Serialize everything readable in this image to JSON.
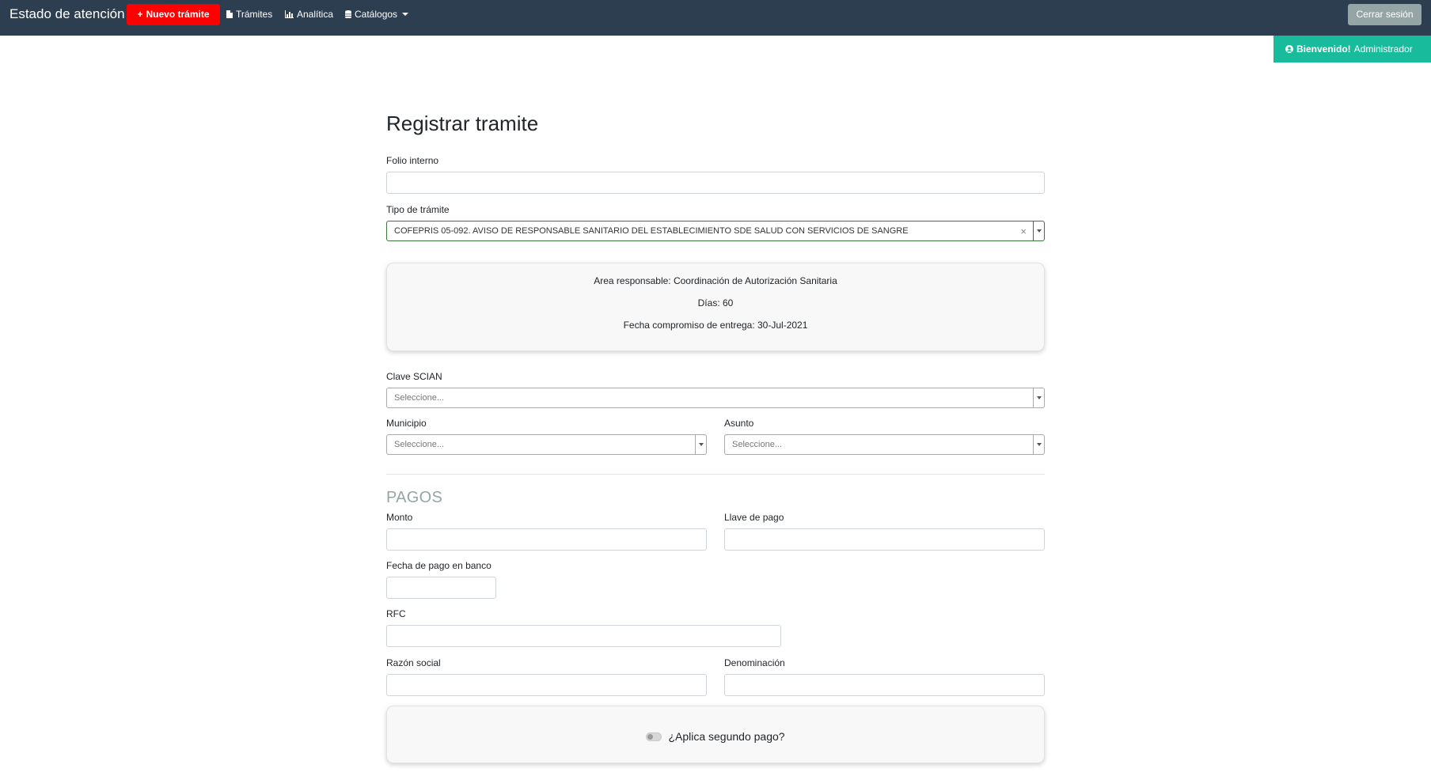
{
  "navbar": {
    "brand": "Estado de atención",
    "new_button": "Nuevo trámite",
    "links": {
      "tramites": "Trámites",
      "analitica": "Analítica",
      "catalogos": "Catálogos"
    },
    "logout_button": "Cerrar sesión",
    "colors": {
      "background": "#2c3e50",
      "new_button": "#ff0000",
      "logout_button": "#95a5a6"
    }
  },
  "welcome": {
    "bold": "Bienvenido!",
    "user": "Administrador",
    "color": "#18bc9c"
  },
  "form": {
    "title": "Registrar tramite",
    "folio": {
      "label": "Folio interno",
      "value": ""
    },
    "tipo": {
      "label": "Tipo de trámite",
      "value": "COFEPRIS 05-092. AVISO DE RESPONSABLE SANITARIO DEL ESTABLECIMIENTO SDE SALUD CON SERVICIOS DE SANGRE",
      "clear": "×"
    },
    "info_card": {
      "area": "Area responsable: Coordinación de Autorización Sanitaria",
      "dias": "Días: 60",
      "fecha": "Fecha compromiso de entrega: 30-Jul-2021"
    },
    "scian": {
      "label": "Clave SCIAN",
      "placeholder": "Seleccione..."
    },
    "municipio": {
      "label": "Municipio",
      "placeholder": "Seleccione..."
    },
    "asunto": {
      "label": "Asunto",
      "placeholder": "Seleccione..."
    }
  },
  "pagos": {
    "title": "PAGOS",
    "monto": {
      "label": "Monto",
      "value": ""
    },
    "llave": {
      "label": "Llave de pago",
      "value": ""
    },
    "fecha_banco": {
      "label": "Fecha de pago en banco",
      "value": ""
    },
    "rfc": {
      "label": "RFC",
      "value": ""
    },
    "razon_social": {
      "label": "Razón social",
      "value": ""
    },
    "denominacion": {
      "label": "Denominación",
      "value": ""
    },
    "segundo_pago": {
      "label": "¿Aplica segundo pago?",
      "checked": false
    }
  }
}
